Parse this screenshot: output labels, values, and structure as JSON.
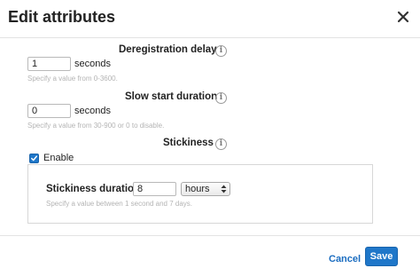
{
  "dialog": {
    "title": "Edit attributes",
    "close_icon": "close-icon"
  },
  "deregistration": {
    "label": "Deregistration delay",
    "value": "1",
    "unit": "seconds",
    "hint": "Specify a value from 0-3600.",
    "info_icon": "info-icon"
  },
  "slow_start": {
    "label": "Slow start duration",
    "value": "0",
    "unit": "seconds",
    "hint": "Specify a value from 30-900 or 0 to disable.",
    "info_icon": "info-icon"
  },
  "stickiness": {
    "label": "Stickiness",
    "info_icon": "info-icon",
    "enable_label": "Enable",
    "enabled": true,
    "duration_label": "Stickiness duration",
    "duration_value": "8",
    "duration_unit": "hours",
    "duration_hint": "Specify a value between 1 second and 7 days."
  },
  "footer": {
    "cancel_label": "Cancel",
    "save_label": "Save"
  },
  "colors": {
    "accent": "#1f77c9",
    "link": "#1a6cc0"
  }
}
